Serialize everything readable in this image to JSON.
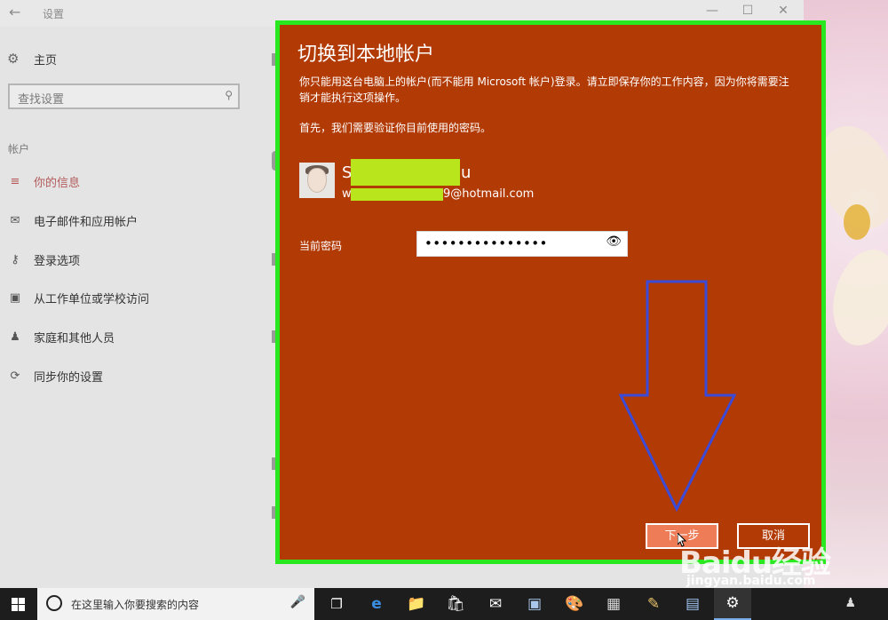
{
  "window": {
    "title": "设置",
    "back_glyph": "←",
    "minimize_glyph": "—",
    "maximize_glyph": "☐",
    "close_glyph": "✕"
  },
  "sidebar": {
    "home": {
      "label": "主页",
      "icon": "gear-icon"
    },
    "search_placeholder": "查找设置",
    "section": "帐户",
    "items": [
      {
        "label": "你的信息",
        "icon": "person-card-icon",
        "active": true
      },
      {
        "label": "电子邮件和应用帐户",
        "icon": "envelope-icon"
      },
      {
        "label": "登录选项",
        "icon": "key-icon"
      },
      {
        "label": "从工作单位或学校访问",
        "icon": "briefcase-icon"
      },
      {
        "label": "家庭和其他人员",
        "icon": "people-icon"
      },
      {
        "label": "同步你的设置",
        "icon": "sync-icon"
      }
    ]
  },
  "dialog": {
    "title": "切换到本地帐户",
    "description": "你只能用这台电脑上的帐户(而不能用 Microsoft 帐户)登录。请立即保存你的工作内容，因为你将需要注销才能执行这项操作。",
    "verify_text": "首先，我们需要验证你目前使用的密码。",
    "account": {
      "name_start": "S",
      "name_end": "u",
      "email_start": "w",
      "email_end": "9@hotmail.com"
    },
    "password_label": "当前密码",
    "password_value": "•••••••••••••••",
    "next_label": "下一步",
    "cancel_label": "取消",
    "colors": {
      "background": "#b23a05",
      "highlight_border": "#2ae81f",
      "mask": "#b8e51c",
      "arrow": "#3b4bd8"
    }
  },
  "taskbar": {
    "search_placeholder": "在这里输入你要搜索的内容",
    "icons": [
      "task-view-icon",
      "edge-icon",
      "file-explorer-icon",
      "store-icon",
      "mail-icon",
      "photos-icon",
      "paint-icon",
      "media-icon",
      "art-icon",
      "network-icon",
      "settings-icon"
    ]
  },
  "watermark": {
    "brand": "Baidu经验",
    "site": "jingyan.baidu.com"
  }
}
